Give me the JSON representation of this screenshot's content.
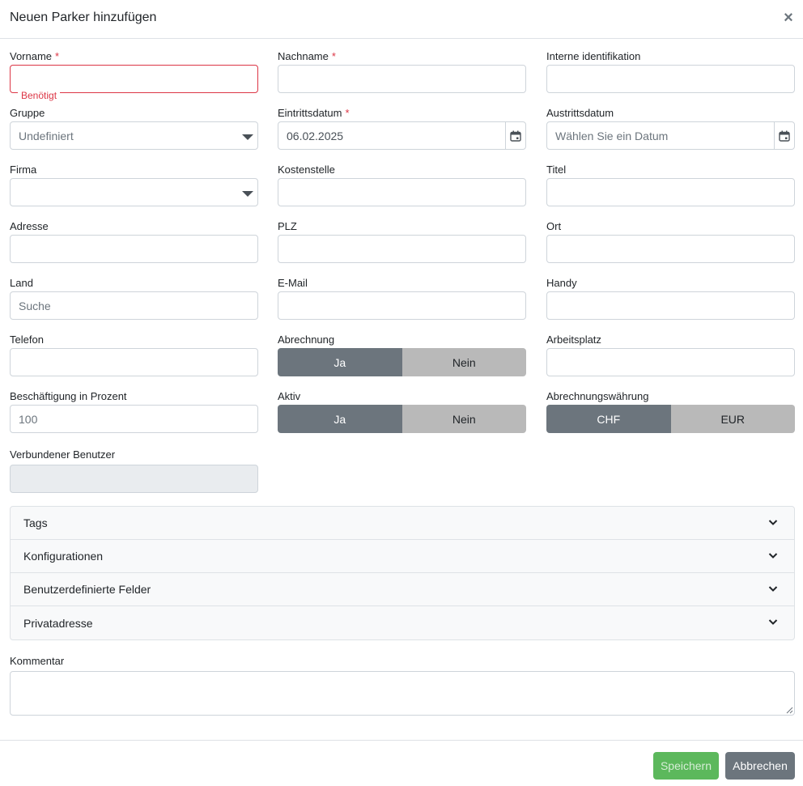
{
  "modal": {
    "title": "Neuen Parker hinzufügen",
    "close_icon": "×"
  },
  "fields": {
    "vorname": {
      "label": "Vorname",
      "required_mark": "*",
      "value": "",
      "error": "Benötigt"
    },
    "nachname": {
      "label": "Nachname",
      "required_mark": "*",
      "value": ""
    },
    "interne_id": {
      "label": "Interne identifikation",
      "value": ""
    },
    "gruppe": {
      "label": "Gruppe",
      "selected": "Undefiniert"
    },
    "eintrittsdatum": {
      "label": "Eintrittsdatum",
      "required_mark": "*",
      "value": "06.02.2025"
    },
    "austrittsdatum": {
      "label": "Austrittsdatum",
      "placeholder": "Wählen Sie ein Datum"
    },
    "firma": {
      "label": "Firma",
      "selected": ""
    },
    "kostenstelle": {
      "label": "Kostenstelle",
      "value": ""
    },
    "titel": {
      "label": "Titel",
      "value": ""
    },
    "adresse": {
      "label": "Adresse",
      "value": ""
    },
    "plz": {
      "label": "PLZ",
      "value": ""
    },
    "ort": {
      "label": "Ort",
      "value": ""
    },
    "land": {
      "label": "Land",
      "placeholder": "Suche"
    },
    "email": {
      "label": "E-Mail",
      "value": ""
    },
    "handy": {
      "label": "Handy",
      "value": ""
    },
    "telefon": {
      "label": "Telefon",
      "value": ""
    },
    "abrechnung": {
      "label": "Abrechnung",
      "options": [
        "Ja",
        "Nein"
      ],
      "selected": "Ja"
    },
    "arbeitsplatz": {
      "label": "Arbeitsplatz",
      "value": ""
    },
    "beschaeftigung": {
      "label": "Beschäftigung in Prozent",
      "placeholder": "100"
    },
    "aktiv": {
      "label": "Aktiv",
      "options": [
        "Ja",
        "Nein"
      ],
      "selected": "Ja"
    },
    "waehrung": {
      "label": "Abrechnungswährung",
      "options": [
        "CHF",
        "EUR"
      ],
      "selected": "CHF"
    },
    "verbundener_benutzer": {
      "label": "Verbundener Benutzer",
      "value": ""
    }
  },
  "accordion": [
    "Tags",
    "Konfigurationen",
    "Benutzerdefinierte Felder",
    "Privatadresse"
  ],
  "kommentar": {
    "label": "Kommentar",
    "value": ""
  },
  "footer": {
    "save_label": "Speichern",
    "cancel_label": "Abbrechen"
  },
  "colors": {
    "toggle_active": "#6c757d",
    "toggle_inactive": "#b9b9b9",
    "required": "#dc3545",
    "save_button": "#5cb85c",
    "cancel_button": "#6c757d"
  },
  "icons": {
    "close": "close-icon",
    "dropdown": "caret-down-icon",
    "date": "calendar-icon",
    "accordion": "chevron-down-icon"
  }
}
